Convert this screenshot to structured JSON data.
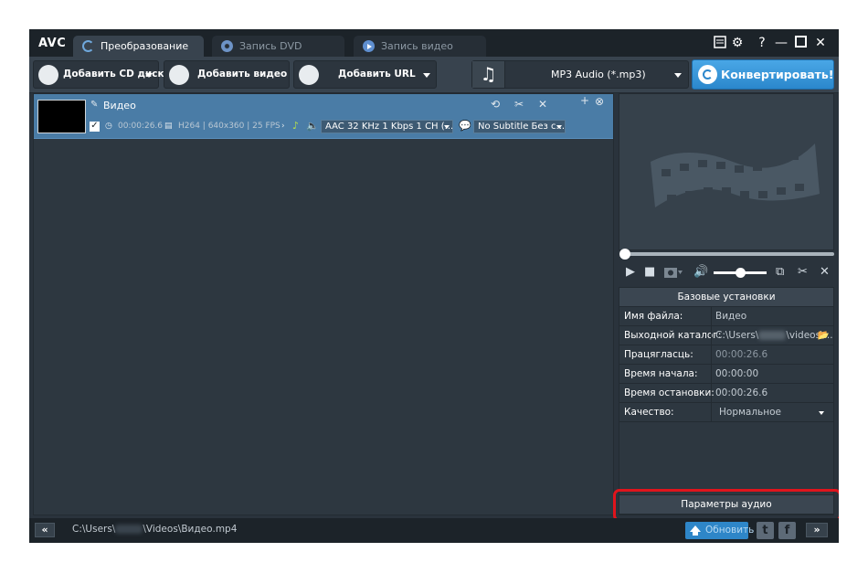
{
  "app": {
    "logo": "AVC"
  },
  "tabs": [
    {
      "label": "Преобразование",
      "active": true
    },
    {
      "label": "Запись DVD",
      "active": false
    },
    {
      "label": "Запись видео",
      "active": false
    }
  ],
  "window_controls": {
    "help": "?",
    "minimize": "—",
    "maximize": "□",
    "close": "✕"
  },
  "toolbar": {
    "add_cd": "Добавить CD диск",
    "add_video": "Добавить видео",
    "add_url": "Добавить URL",
    "format": "MP3 Audio (*.mp3)",
    "convert": "Конвертировать!"
  },
  "file": {
    "title": "Видео",
    "duration": "00:00:26.6",
    "video_info": "H264 | 640x360 | 25 FPS",
    "audio_track": "AAC 32 KHz 1 Kbps 1 CH (...",
    "subtitle": "No Subtitle Без с..."
  },
  "settings": {
    "title": "Базовые установки",
    "rows": [
      {
        "key": "Имя файла:",
        "value": "Видео"
      },
      {
        "key": "Выходной каталог:",
        "value_prefix": "C:\\Users\\",
        "value_suffix": "\\videos\\..."
      },
      {
        "key": "Працягласць:",
        "value": "00:00:26.6"
      },
      {
        "key": "Время начала:",
        "value": "00:00:00"
      },
      {
        "key": "Время остановки:",
        "value": "00:00:26.6"
      },
      {
        "key": "Качество:",
        "value": "Нормальное"
      }
    ],
    "audio_params_button": "Параметры аудио"
  },
  "statusbar": {
    "collapse": "«",
    "path_prefix": "C:\\Users\\",
    "path_suffix": "\\Videos\\Видео.mp4",
    "update": "Обновить",
    "twitter": "t",
    "facebook": "f",
    "expand": "»"
  },
  "colors": {
    "accent": "#2b87cc",
    "highlight": "#e0141c",
    "selected_row": "#4a7ca6"
  },
  "progress": {
    "seek_fraction": 0.0,
    "volume_fraction": 0.45
  }
}
